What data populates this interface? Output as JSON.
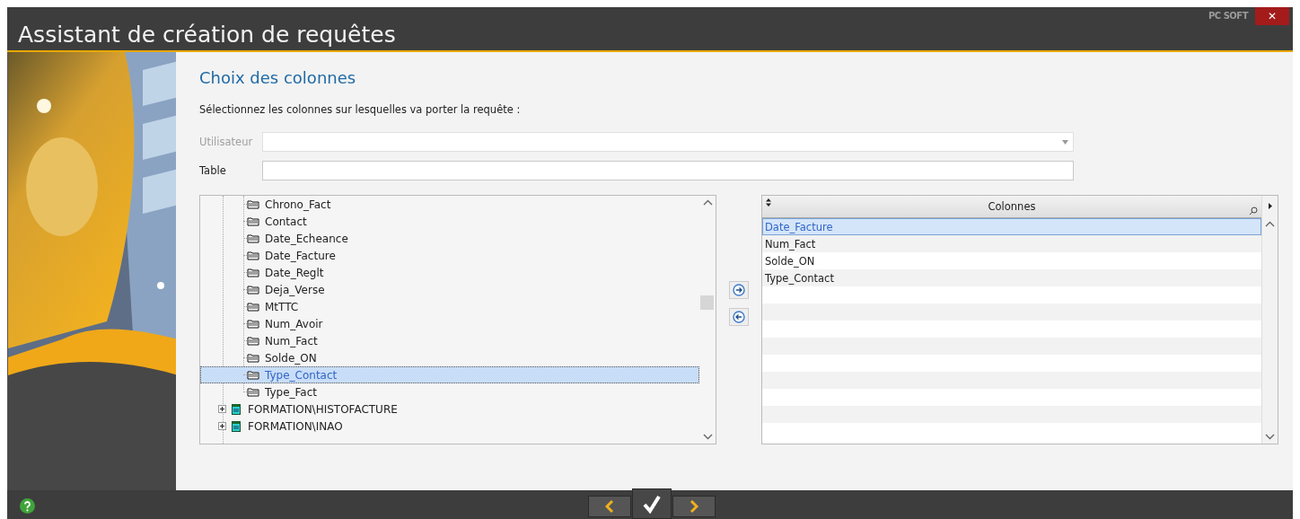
{
  "window": {
    "title": "Assistant de création de requêtes",
    "brand": "PC SOFT",
    "close": "✕"
  },
  "step": {
    "heading": "Choix des colonnes",
    "instruction": "Sélectionnez les colonnes sur lesquelles va porter la requête :"
  },
  "fields": [
    {
      "kind": "combo",
      "label": "Utilisateur",
      "disabled": true
    },
    {
      "kind": "text",
      "label": "Table",
      "disabled": false
    }
  ],
  "tree": {
    "items": [
      {
        "kind": "table",
        "children": [
          {
            "kind": "field",
            "label": "Chrono_Fact",
            "selected": false
          },
          {
            "kind": "field",
            "label": "Contact",
            "selected": false
          },
          {
            "kind": "field",
            "label": "Date_Echeance",
            "selected": false
          },
          {
            "kind": "field",
            "label": "Date_Facture",
            "selected": false
          },
          {
            "kind": "field",
            "label": "Date_Reglt",
            "selected": false
          },
          {
            "kind": "field",
            "label": "Deja_Verse",
            "selected": false
          },
          {
            "kind": "field",
            "label": "MtTTC",
            "selected": false
          },
          {
            "kind": "field",
            "label": "Num_Avoir",
            "selected": false
          },
          {
            "kind": "field",
            "label": "Num_Fact",
            "selected": false
          },
          {
            "kind": "field",
            "label": "Solde_ON",
            "selected": false
          },
          {
            "kind": "field",
            "label": "Type_Contact",
            "selected": true
          },
          {
            "kind": "field",
            "label": "Type_Fact",
            "selected": false
          }
        ]
      },
      {
        "kind": "table",
        "label": "FORMATION\\HISTOFACTURE",
        "expanded": false
      },
      {
        "kind": "table",
        "label": "FORMATION\\INAO",
        "expanded": false
      }
    ]
  },
  "columns": {
    "header": "Colonnes",
    "rows": [
      {
        "label": "Date_Facture",
        "selected": true
      },
      {
        "label": "Num_Fact",
        "selected": false
      },
      {
        "label": "Solde_ON",
        "selected": false
      },
      {
        "label": "Type_Contact",
        "selected": false
      }
    ]
  }
}
